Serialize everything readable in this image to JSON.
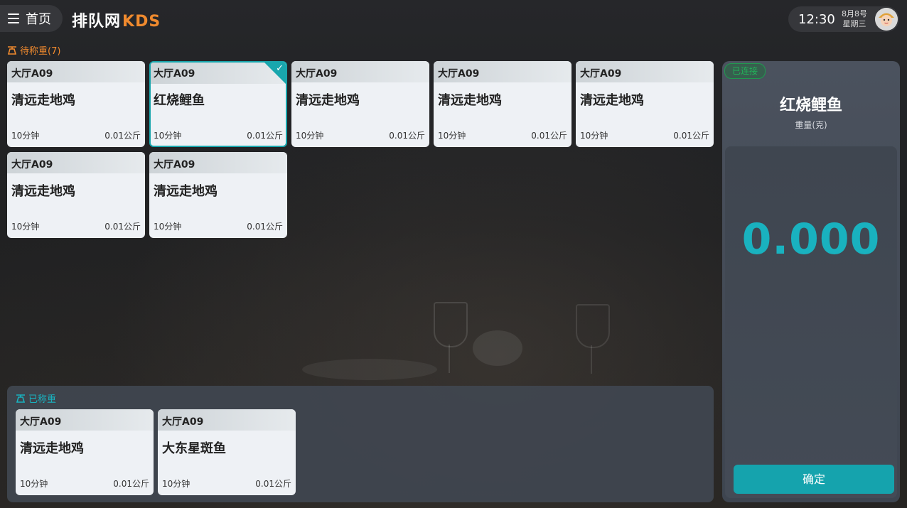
{
  "header": {
    "home_label": "首页",
    "brand_a": "排队网",
    "brand_b": "KDS",
    "time": "12:30",
    "date": "8月8号",
    "weekday": "星期三"
  },
  "pending": {
    "title": "待称重(7)",
    "cards": [
      {
        "table": "大厅A09",
        "dish": "清远走地鸡",
        "time": "10分钟",
        "weight": "0.01公斤",
        "selected": false
      },
      {
        "table": "大厅A09",
        "dish": "红烧鲤鱼",
        "time": "10分钟",
        "weight": "0.01公斤",
        "selected": true
      },
      {
        "table": "大厅A09",
        "dish": "清远走地鸡",
        "time": "10分钟",
        "weight": "0.01公斤",
        "selected": false
      },
      {
        "table": "大厅A09",
        "dish": "清远走地鸡",
        "time": "10分钟",
        "weight": "0.01公斤",
        "selected": false
      },
      {
        "table": "大厅A09",
        "dish": "清远走地鸡",
        "time": "10分钟",
        "weight": "0.01公斤",
        "selected": false
      },
      {
        "table": "大厅A09",
        "dish": "清远走地鸡",
        "time": "10分钟",
        "weight": "0.01公斤",
        "selected": false
      },
      {
        "table": "大厅A09",
        "dish": "清远走地鸡",
        "time": "10分钟",
        "weight": "0.01公斤",
        "selected": false
      }
    ]
  },
  "weighed": {
    "title": "已称重",
    "cards": [
      {
        "table": "大厅A09",
        "dish": "清远走地鸡",
        "time": "10分钟",
        "weight": "0.01公斤"
      },
      {
        "table": "大厅A09",
        "dish": "大东星斑鱼",
        "time": "10分钟",
        "weight": "0.01公斤"
      }
    ]
  },
  "scale": {
    "status": "已连接",
    "dish": "红烧鲤鱼",
    "unit_label": "重量(克)",
    "value": "0.000",
    "confirm_label": "确定"
  },
  "colors": {
    "accent": "#19b2bf",
    "brand_orange": "#f08a2e",
    "connected_green": "#22b35a"
  },
  "icons": [
    "menu-icon",
    "scale-icon",
    "check-icon",
    "avatar"
  ]
}
